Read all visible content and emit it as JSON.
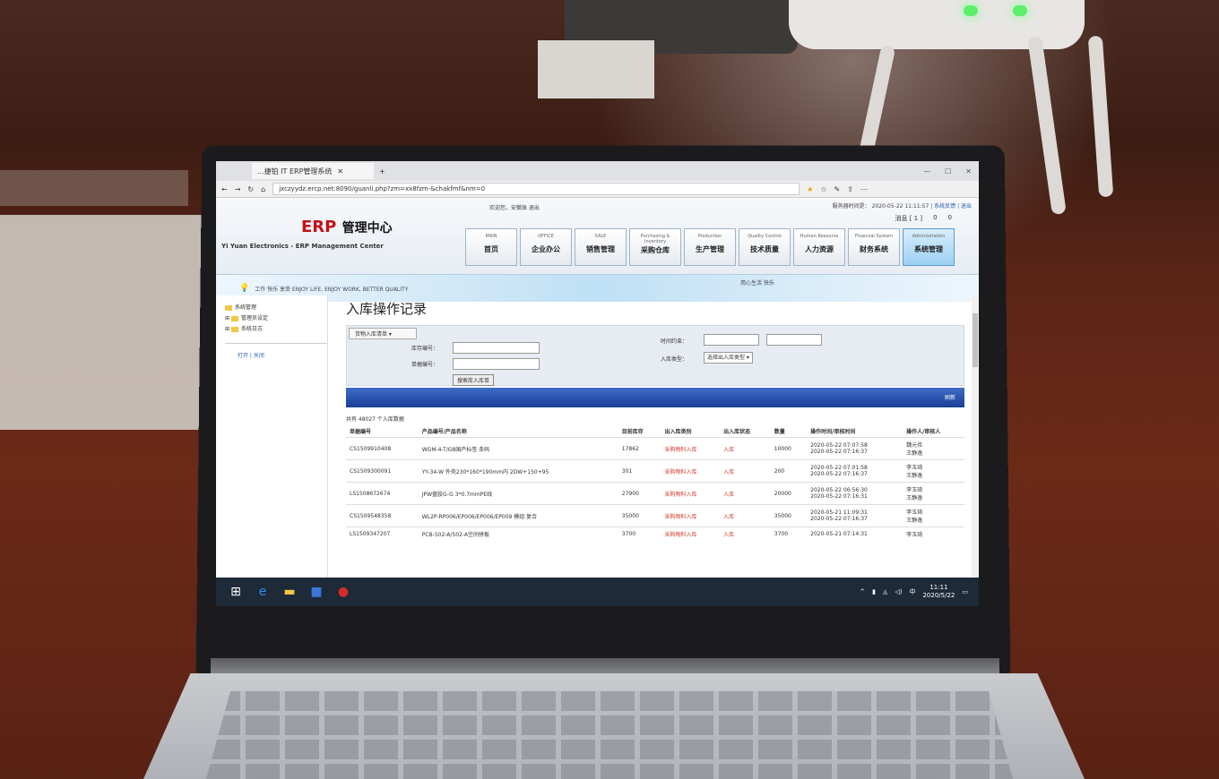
{
  "browser": {
    "tab_title": "...捷铂 IT ERP管理系统",
    "url": "jxczyydz.ercp.net:8090/guanli.php?zm=xx8fzm-&chakfmf&nm=0"
  },
  "header": {
    "logo_erp": "ERP",
    "logo_cn": "管理中心",
    "logo_sub": "Yi Yuan Electronics - ERP Management Center",
    "user_info": "欢迎您，安徽珠 退出",
    "time_info": "服务器时间是：  2020-05-22 11:11:57",
    "links": "| 系统反馈 | 退出",
    "tools": [
      "消息 [ 1 ]",
      "0",
      "0"
    ]
  },
  "nav": [
    {
      "en": "MAIN",
      "cn": "首页"
    },
    {
      "en": "OFFICE",
      "cn": "企业办公"
    },
    {
      "en": "SALE",
      "cn": "销售管理"
    },
    {
      "en": "Purchasing & Inventory",
      "cn": "采购仓库"
    },
    {
      "en": "Production",
      "cn": "生产管理"
    },
    {
      "en": "Quality Control",
      "cn": "技术质量"
    },
    {
      "en": "Human Resource",
      "cn": "人力资源"
    },
    {
      "en": "Financial System",
      "cn": "财务系统"
    },
    {
      "en": "Administration",
      "cn": "系统管理"
    }
  ],
  "banner": {
    "slogan": "工作 快乐 享受 ENJOY LIFE, ENJOY WORK, BETTER QUALITY",
    "right": "用心生活 快乐"
  },
  "sidebar": {
    "root": "系统管理",
    "items": [
      "管理员设定",
      "系统日志"
    ],
    "expand": "打开",
    "collapse": "关闭"
  },
  "main": {
    "title": "入库操作记录",
    "select": "货物入库清单",
    "product_label": "库存编号：",
    "order_label": "单据编号：",
    "time_label": "时间约束：",
    "type_label": "入库类型：",
    "type_select": "选择出入库类型",
    "search_button": "搜索库入库单",
    "bar_label": "刷新",
    "count": "共有 48027 个入库数据",
    "columns": [
      "单据编号",
      "产品编号/产品名称",
      "目前库存",
      "出入库类别",
      "出入库状态",
      "数量",
      "操作时间/审核时间",
      "操作人/审核人"
    ],
    "rows": [
      [
        "CS1509910408",
        "WGM-4-T/G8国产标签 条码",
        "17862",
        "采购物料入库",
        "入库",
        "10000",
        "2020-05-22 07:07:58\n2020-05-22 07:16:37",
        "魏元伟\n王静逸"
      ],
      [
        "CS1509300091",
        "YY-34-W 外壳230*160*190mm内 2DW+150+95",
        "301",
        "采购物料入库",
        "入库",
        "200",
        "2020-05-22 07:01:58\n2020-05-22 07:16:37",
        "李玉琦\n王静逸"
      ],
      [
        "LS1508672674",
        "JPW盘胶G-G 3*0.7mmPE线",
        "27900",
        "采购物料入库",
        "入库",
        "20000",
        "2020-05-22 06:56:30\n2020-05-22 07:16:31",
        "李玉琦\n王静逸"
      ],
      [
        "CS1509548358",
        "WL2P-RP006/EP006/EP006/EP009 模组 复合",
        "35000",
        "采购物料入库",
        "入库",
        "35000",
        "2020-05-21 11:09:31\n2020-05-22 07:16:37",
        "李玉琦\n王静逸"
      ],
      [
        "LS1509347207",
        "PCB-502-A/502-A空间拼板",
        "3700",
        "采购物料入库",
        "入库",
        "3700",
        "2020-05-21 07:14:31",
        "李玉琦"
      ]
    ]
  },
  "taskbar": {
    "time": "11:11",
    "date": "2020/5/22",
    "ime": "中"
  }
}
